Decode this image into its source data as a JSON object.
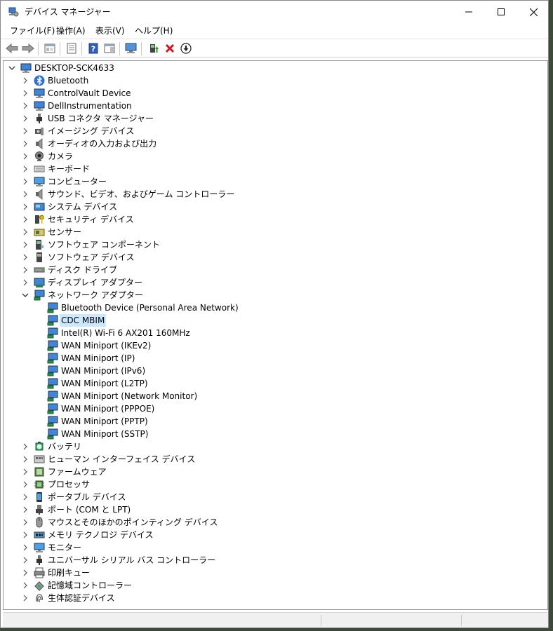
{
  "window": {
    "title": "デバイス マネージャー",
    "icon": "device-manager-icon"
  },
  "menu": [
    "ファイル(F)",
    "操作(A)",
    "表示(V)",
    "ヘルプ(H)"
  ],
  "toolbar": {
    "buttons": [
      "back-arrow-icon",
      "forward-arrow-icon",
      "show-hide-console-tree-icon",
      "properties-icon",
      "help-icon",
      "action-pane-icon",
      "monitor-scan-icon",
      "update-driver-icon",
      "uninstall-device-icon",
      "disable-device-icon"
    ]
  },
  "tree": {
    "root": "DESKTOP-SCK4633",
    "categories": [
      {
        "label": "Bluetooth",
        "icon": "bluetooth-icon"
      },
      {
        "label": "ControlVault Device",
        "icon": "monitor-device-icon"
      },
      {
        "label": "DellInstrumentation",
        "icon": "monitor-device-icon"
      },
      {
        "label": "USB コネクタ マネージャー",
        "icon": "usb-icon"
      },
      {
        "label": "イメージング デバイス",
        "icon": "camera-imaging-icon"
      },
      {
        "label": "オーディオの入力および出力",
        "icon": "speaker-icon"
      },
      {
        "label": "カメラ",
        "icon": "webcam-icon"
      },
      {
        "label": "キーボード",
        "icon": "keyboard-icon"
      },
      {
        "label": "コンピューター",
        "icon": "computer-icon"
      },
      {
        "label": "サウンド、ビデオ、およびゲーム コントローラー",
        "icon": "speaker-icon"
      },
      {
        "label": "システム デバイス",
        "icon": "system-device-icon"
      },
      {
        "label": "セキュリティ デバイス",
        "icon": "security-key-icon"
      },
      {
        "label": "センサー",
        "icon": "sensor-icon"
      },
      {
        "label": "ソフトウェア コンポーネント",
        "icon": "software-component-icon"
      },
      {
        "label": "ソフトウェア デバイス",
        "icon": "software-device-icon"
      },
      {
        "label": "ディスク ドライブ",
        "icon": "disk-drive-icon"
      },
      {
        "label": "ディスプレイ アダプター",
        "icon": "display-adapter-icon"
      },
      {
        "label": "ネットワーク アダプター",
        "icon": "network-adapter-icon",
        "expanded": true,
        "children": [
          "Bluetooth Device (Personal Area Network)",
          "CDC MBIM",
          "Intel(R) Wi-Fi 6 AX201 160MHz",
          "WAN Miniport (IKEv2)",
          "WAN Miniport (IP)",
          "WAN Miniport (IPv6)",
          "WAN Miniport (L2TP)",
          "WAN Miniport (Network Monitor)",
          "WAN Miniport (PPPOE)",
          "WAN Miniport (PPTP)",
          "WAN Miniport (SSTP)"
        ]
      },
      {
        "label": "バッテリ",
        "icon": "battery-icon"
      },
      {
        "label": "ヒューマン インターフェイス デバイス",
        "icon": "hid-icon"
      },
      {
        "label": "ファームウェア",
        "icon": "firmware-icon"
      },
      {
        "label": "プロセッサ",
        "icon": "processor-icon"
      },
      {
        "label": "ポータブル デバイス",
        "icon": "portable-device-icon"
      },
      {
        "label": "ポート (COM と LPT)",
        "icon": "port-icon"
      },
      {
        "label": "マウスとそのほかのポインティング デバイス",
        "icon": "mouse-icon"
      },
      {
        "label": "メモリ テクノロジ デバイス",
        "icon": "memory-icon"
      },
      {
        "label": "モニター",
        "icon": "monitor-icon"
      },
      {
        "label": "ユニバーサル シリアル バス コントローラー",
        "icon": "usb-icon"
      },
      {
        "label": "印刷キュー",
        "icon": "printer-icon"
      },
      {
        "label": "記憶域コントローラー",
        "icon": "storage-controller-icon"
      },
      {
        "label": "生体認証デバイス",
        "icon": "fingerprint-icon"
      }
    ],
    "selected_child": "CDC MBIM"
  },
  "colors": {
    "selection": "#cce8ff",
    "icon_blue": "#2f7fd6",
    "uninstall_red": "#d4141e"
  }
}
